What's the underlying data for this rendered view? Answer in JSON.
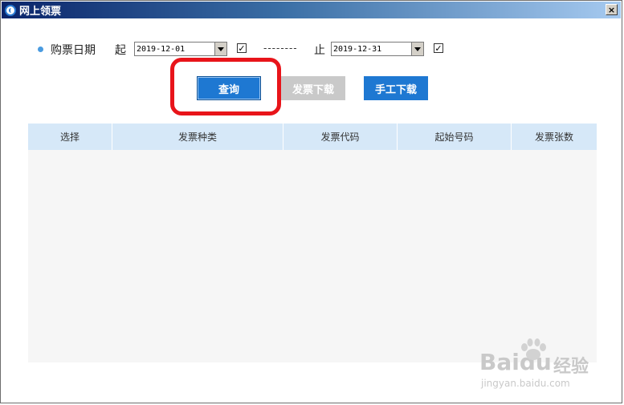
{
  "window": {
    "title": "网上领票",
    "close_glyph": "×"
  },
  "filter": {
    "date_label": "购票日期",
    "start_label": "起",
    "start_date": "2019-12-01",
    "start_checked": "✓",
    "separator": "--------",
    "end_label": "止",
    "end_date": "2019-12-31",
    "end_checked": "✓"
  },
  "buttons": {
    "query": "查询",
    "download": "发票下载",
    "manual_download": "手工下载"
  },
  "table": {
    "columns": [
      "选择",
      "发票种类",
      "发票代码",
      "起始号码",
      "发票张数"
    ],
    "rows": []
  },
  "watermark": {
    "brand": "Bai",
    "brand_suffix": "du",
    "text": "经验",
    "url": "jingyan.baidu.com"
  },
  "colors": {
    "accent": "#1e78d2",
    "highlight": "#e8141a",
    "header_bg": "#d6e8f8"
  }
}
